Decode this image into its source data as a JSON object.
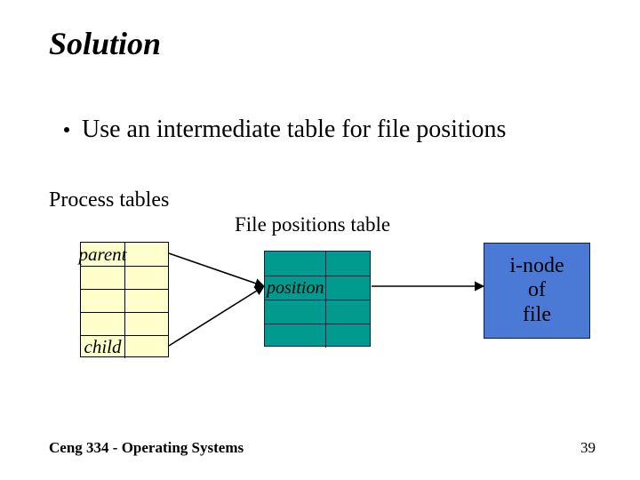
{
  "title": "Solution",
  "bullet": "Use an intermediate table for file positions",
  "labels": {
    "process_tables": "Process tables",
    "file_positions_table": "File positions table"
  },
  "process_table": {
    "rows": [
      "parent",
      "",
      "",
      "",
      "child"
    ]
  },
  "file_positions_table": {
    "rows": [
      "",
      "position",
      "",
      ""
    ]
  },
  "inode_box": "i-node\nof\nfile",
  "footer": "Ceng 334 - Operating Systems",
  "page_number": "39"
}
